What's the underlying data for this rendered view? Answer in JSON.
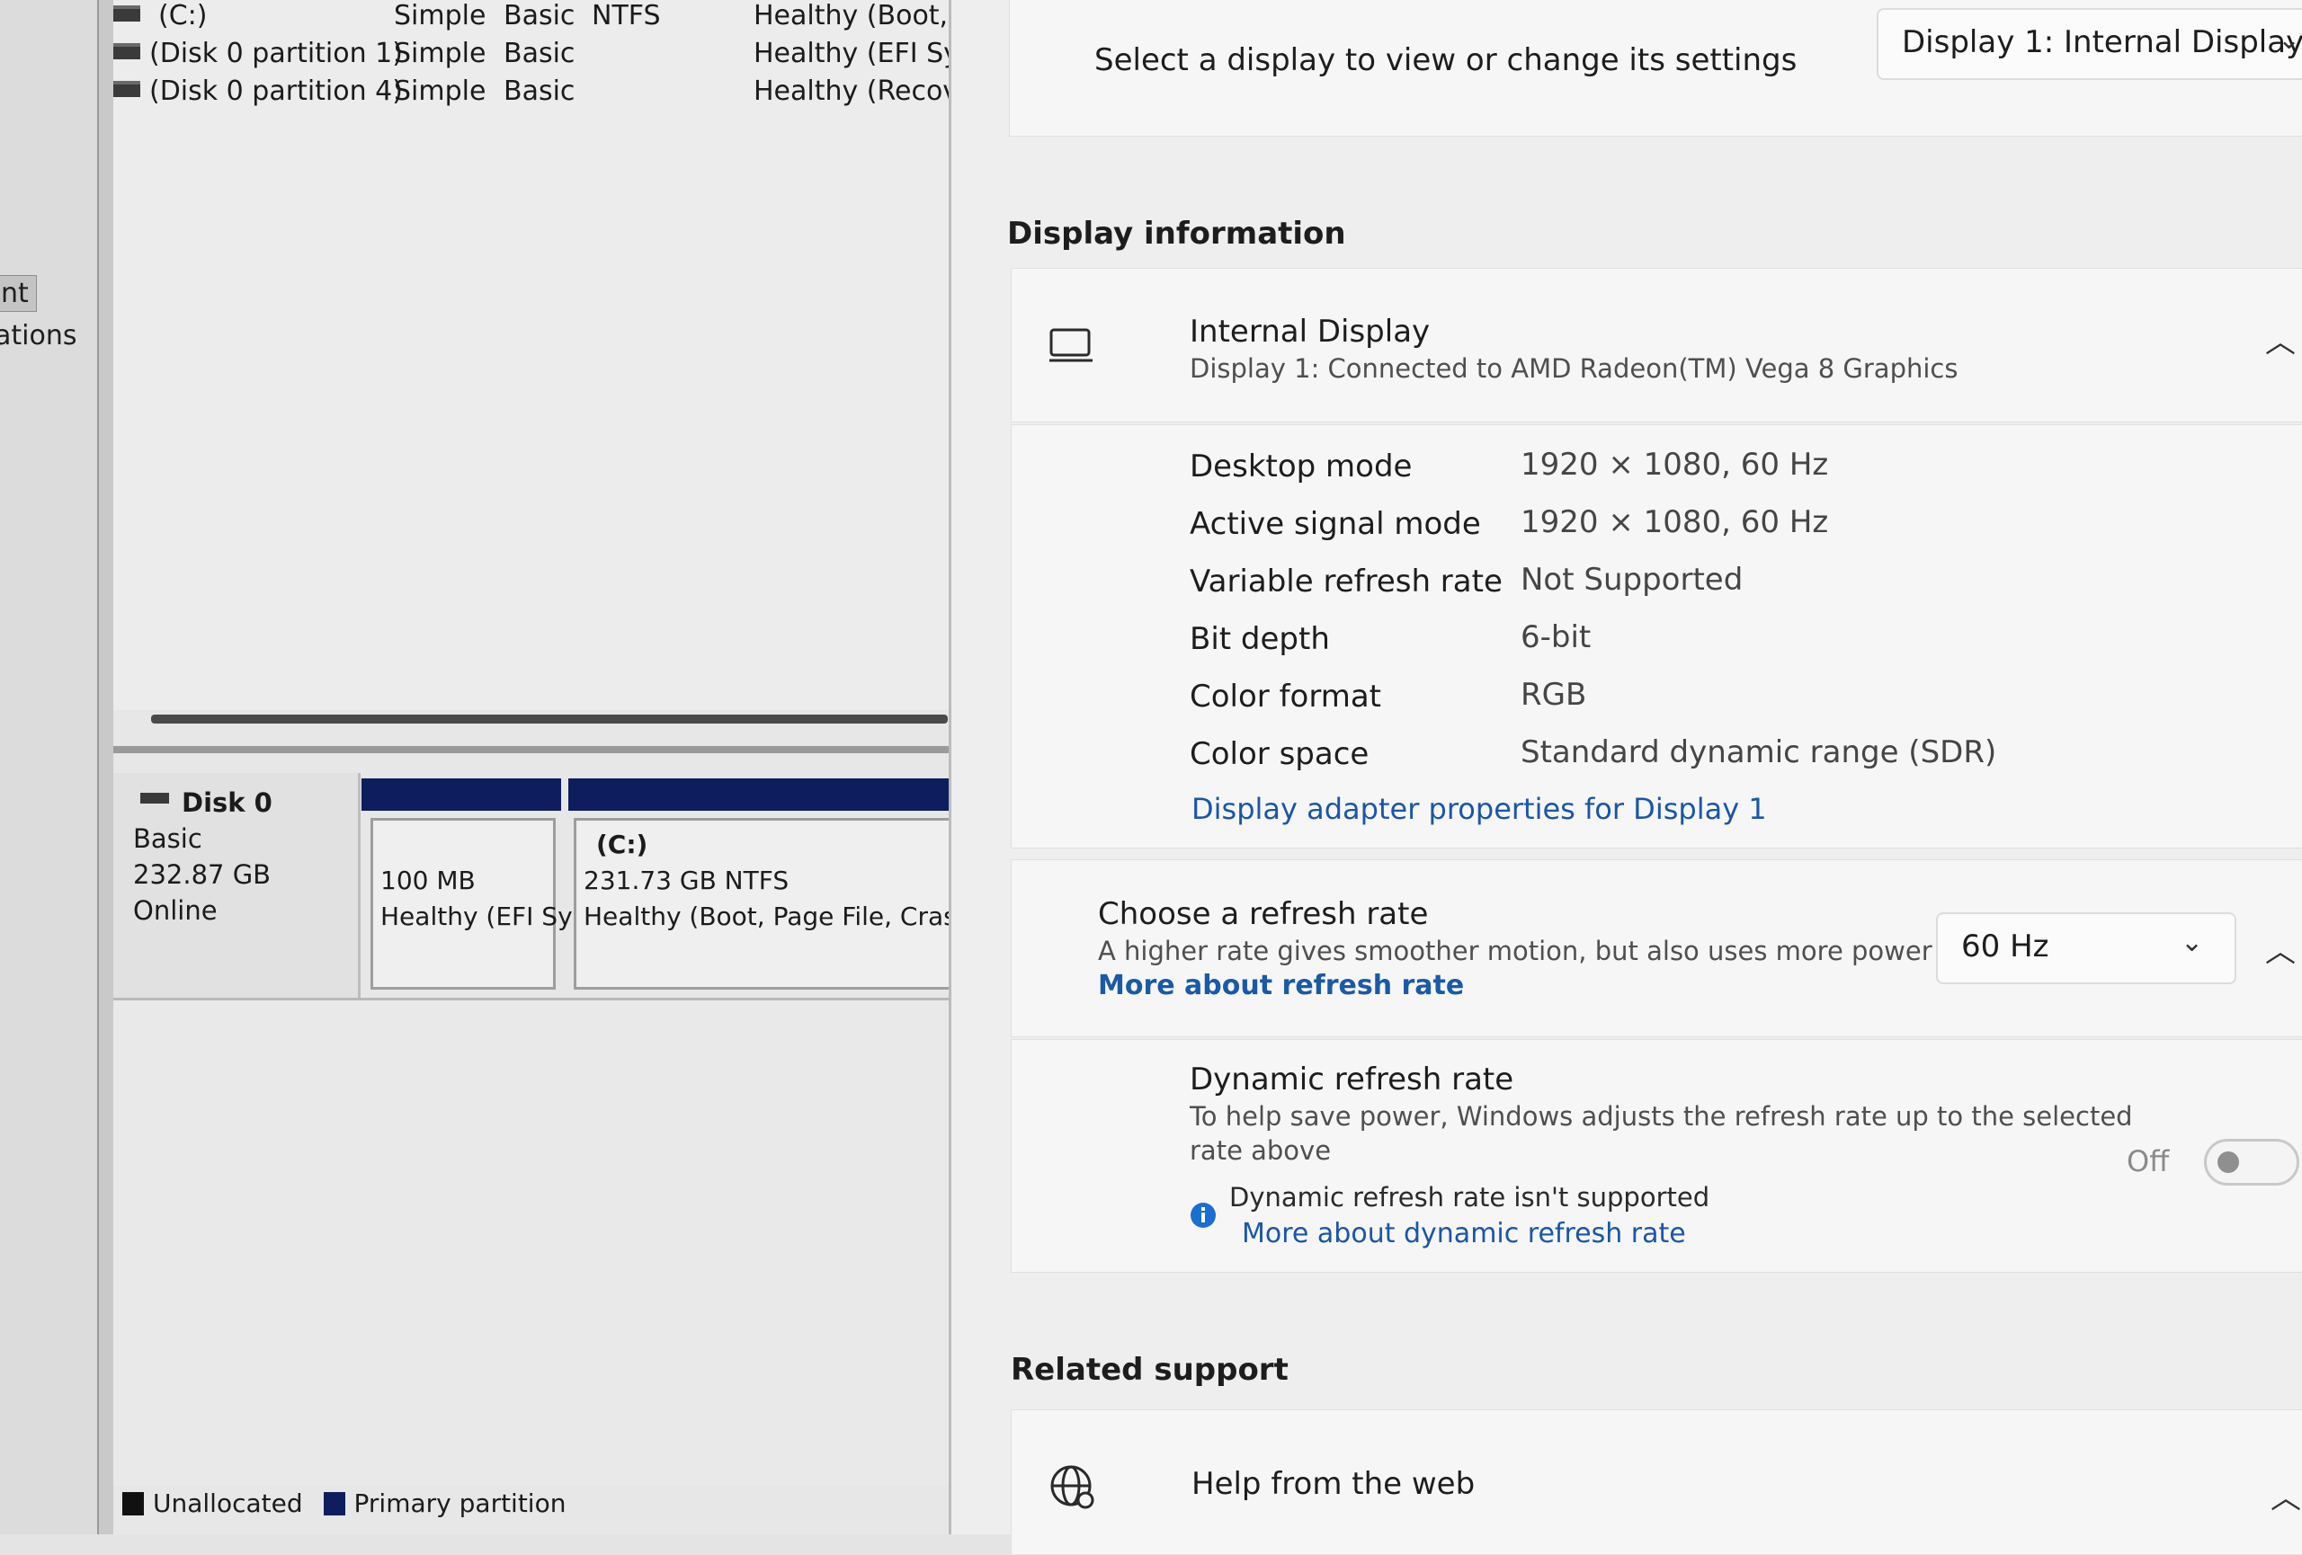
{
  "disk_mgmt": {
    "sidebar": {
      "item1": "nt",
      "item2": "ations"
    },
    "volumes": [
      {
        "name": "(C:)",
        "layout": "Simple",
        "type": "Basic",
        "fs": "NTFS",
        "status": "Healthy (Boot, P"
      },
      {
        "name": "(Disk 0 partition 1)",
        "layout": "Simple",
        "type": "Basic",
        "fs": "",
        "status": "Healthy (EFI Sys"
      },
      {
        "name": "(Disk 0 partition 4)",
        "layout": "Simple",
        "type": "Basic",
        "fs": "",
        "status": "Healthy (Recove"
      }
    ],
    "disk0": {
      "name": "Disk 0",
      "type": "Basic",
      "size": "232.87 GB",
      "state": "Online"
    },
    "partitions": [
      {
        "label": "",
        "size": "100 MB",
        "status": "Healthy (EFI Sy"
      },
      {
        "label": "(C:)",
        "size": "231.73 GB NTFS",
        "status": "Healthy (Boot, Page File, Crash"
      }
    ],
    "legend": {
      "unallocated": "Unallocated",
      "primary": "Primary partition"
    },
    "colors": {
      "primary": "#0e1d5e",
      "unallocated": "#111111"
    }
  },
  "settings": {
    "select_display": {
      "label": "Select a display to view or change its settings",
      "value": "Display 1: Internal Display"
    },
    "display_info": {
      "heading": "Display information",
      "title": "Internal Display",
      "subtitle": "Display 1: Connected to AMD Radeon(TM) Vega 8 Graphics",
      "rows": [
        {
          "label": "Desktop mode",
          "value": "1920 × 1080, 60 Hz"
        },
        {
          "label": "Active signal mode",
          "value": "1920 × 1080, 60 Hz"
        },
        {
          "label": "Variable refresh rate",
          "value": "Not Supported"
        },
        {
          "label": "Bit depth",
          "value": "6-bit"
        },
        {
          "label": "Color format",
          "value": "RGB"
        },
        {
          "label": "Color space",
          "value": "Standard dynamic range (SDR)"
        }
      ],
      "adapter_link": "Display adapter properties for Display 1"
    },
    "refresh": {
      "title": "Choose a refresh rate",
      "desc": "A higher rate gives smoother motion, but also uses more power",
      "link": "More about refresh rate",
      "value": "60 Hz"
    },
    "dynamic": {
      "title": "Dynamic refresh rate",
      "desc1": "To help save power, Windows adjusts the refresh rate up to the selected",
      "desc2": "rate above",
      "toggle_label": "Off",
      "note": "Dynamic refresh rate isn't supported",
      "link": "More about dynamic refresh rate"
    },
    "related": {
      "heading": "Related support",
      "help": "Help from the web"
    },
    "colors": {
      "link": "#1a56a8",
      "info": "#1a6fd0"
    }
  }
}
